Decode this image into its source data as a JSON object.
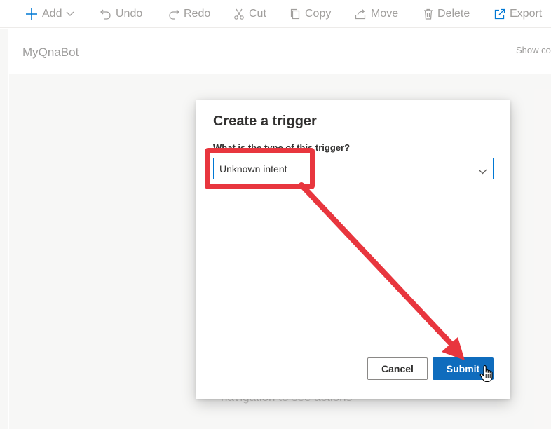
{
  "toolbar": {
    "add": "Add",
    "undo": "Undo",
    "redo": "Redo",
    "cut": "Cut",
    "copy": "Copy",
    "move": "Move",
    "delete": "Delete",
    "export": "Export"
  },
  "header": {
    "bot_name": "MyQnaBot",
    "show_code": "Show co"
  },
  "canvas": {
    "hint": "navigation to see actions"
  },
  "dialog": {
    "title": "Create a trigger",
    "field_label": "What is the type of this trigger?",
    "selected_trigger": "Unknown intent",
    "cancel_label": "Cancel",
    "submit_label": "Submit"
  },
  "colors": {
    "accent": "#0f6cbd",
    "annotation": "#e8363e"
  },
  "icons": [
    "plus-icon",
    "chevron-down-icon",
    "undo-icon",
    "redo-icon",
    "scissors-icon",
    "copy-icon",
    "move-icon",
    "trash-icon",
    "export-icon",
    "hand-cursor-icon"
  ]
}
